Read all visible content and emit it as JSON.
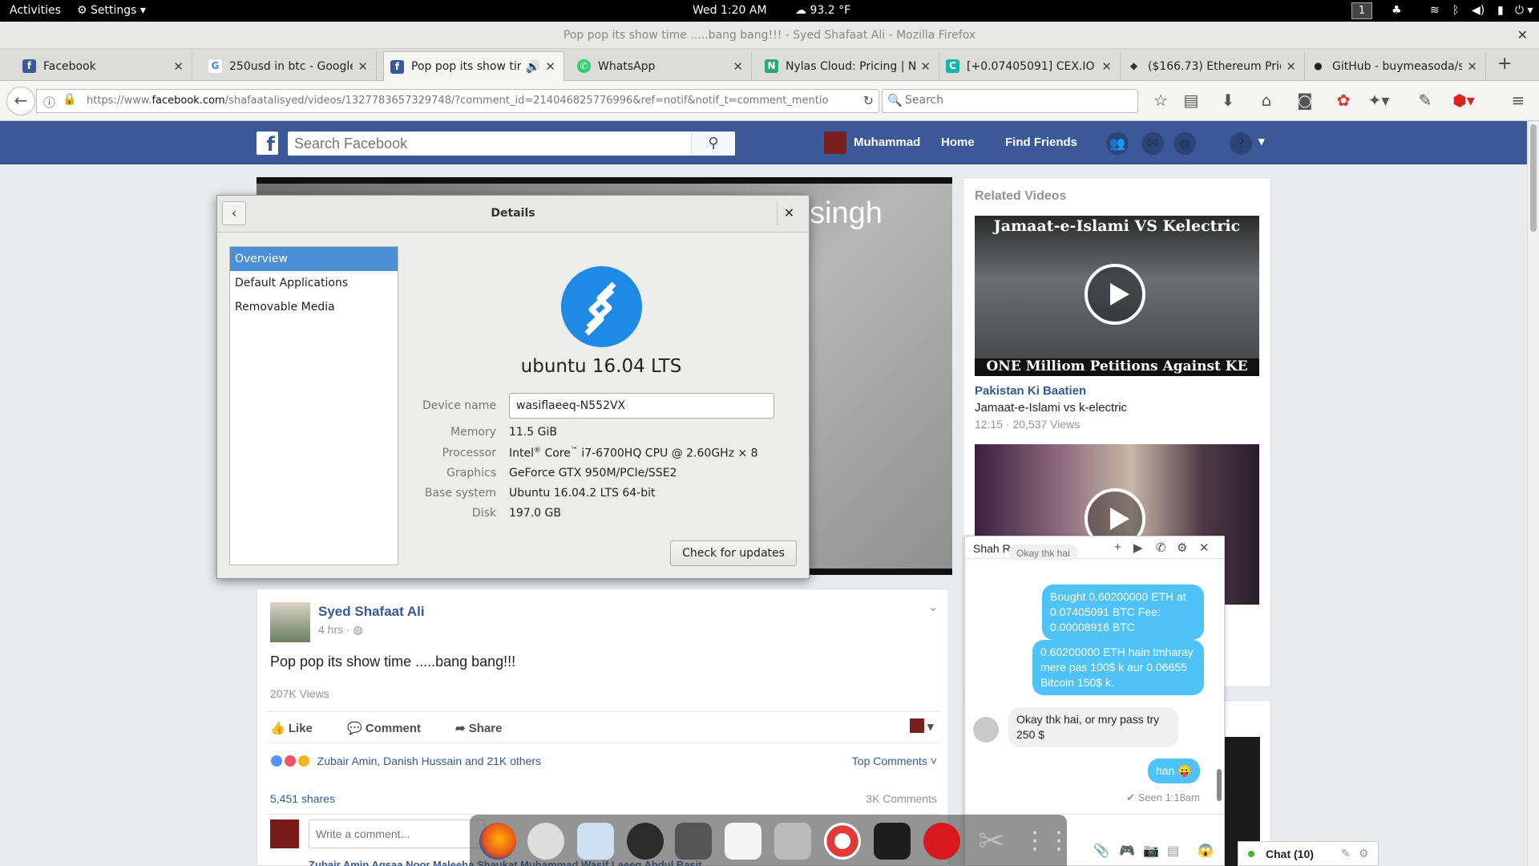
{
  "topbar": {
    "activities": "Activities",
    "settings_menu": "Settings ▾",
    "clock": "Wed  1:20 AM",
    "weather": "93.2 °F",
    "workspace": "1"
  },
  "window": {
    "title": "Pop pop its show time .....bang bang!!! - Syed Shafaat Ali - Mozilla Firefox"
  },
  "tabs": [
    {
      "label": "Facebook",
      "color": "#3b5998",
      "glyph": "f"
    },
    {
      "label": "250usd in btc - Google S",
      "color": "#ffffff",
      "glyph": "G"
    },
    {
      "label": "Pop pop its show tim",
      "color": "#3b5998",
      "glyph": "f"
    },
    {
      "label": "WhatsApp",
      "color": "#25d366",
      "glyph": "✆"
    },
    {
      "label": "Nylas Cloud: Pricing | N",
      "color": "#2aa876",
      "glyph": "N"
    },
    {
      "label": "[+0.07405091] CEX.IO",
      "color": "#19b5a4",
      "glyph": "C"
    },
    {
      "label": "($166.73) Ethereum Pric",
      "color": "#333333",
      "glyph": "◆"
    },
    {
      "label": "GitHub - buymeasoda/sc",
      "color": "#222222",
      "glyph": "●"
    }
  ],
  "navbar": {
    "url_host": "https://www.",
    "url_domain": "facebook.com",
    "url_path": "/shafaatalisyed/videos/1327783657329748/?comment_id=214046825776996&ref=notif&notif_t=comment_mentio",
    "search_placeholder": "Search"
  },
  "facebook": {
    "search_placeholder": "Search Facebook",
    "user_name": "Muhammad",
    "home": "Home",
    "find_friends": "Find Friends"
  },
  "video": {
    "caption_fragment": "singh"
  },
  "details_dialog": {
    "title": "Details",
    "sidebar": [
      "Overview",
      "Default Applications",
      "Removable Media"
    ],
    "os_name": "ubuntu 16.04 LTS",
    "device_name_label": "Device name",
    "device_name_value": "wasiflaeeq-N552VX",
    "memory_label": "Memory",
    "memory_value": "11.5 GiB",
    "processor_label": "Processor",
    "processor_brand": "Intel",
    "processor_core": "Core",
    "processor_model": "i7-6700HQ CPU @ 2.60GHz × 8",
    "graphics_label": "Graphics",
    "graphics_value": "GeForce GTX 950M/PCIe/SSE2",
    "base_label": "Base system",
    "base_value": "Ubuntu 16.04.2 LTS 64-bit",
    "disk_label": "Disk",
    "disk_value": "197.0 GB",
    "update_button": "Check for updates"
  },
  "post": {
    "author": "Syed Shafaat Ali",
    "time": "4 hrs · ",
    "text": "Pop pop its show time .....bang bang!!!",
    "views": "207K Views",
    "like": "Like",
    "comment": "Comment",
    "share": "Share",
    "reactions": "Zubair Amin, Danish Hussain and 21K others",
    "top_comments": "Top Comments ˅",
    "shares": "5,451 shares",
    "comments_count": "3K Comments",
    "comment_placeholder": "Write a comment...",
    "below_names": "Zubair Amin  Aqsaa Noor Maleeha  Shaukat Muhammad  Wasif Laeeq  Abdul Basit"
  },
  "related": {
    "header": "Related Videos",
    "video1_top_text": "Jamaat-e-Islami VS Kelectric",
    "video1_bottom_text": "ONE Milliom Petitions Against KE",
    "video1_channel": "Pakistan Ki Baatien",
    "video1_title": "Jamaat-e-Islami vs k-electric",
    "video1_meta": "12:15 · 20,537 Views"
  },
  "chat": {
    "name": "Shah Rukh",
    "partial_message": "Okay thk hai",
    "msg1": "Bought 0.60200000 ETH at 0.07405091 BTC Fee: 0.00008916 BTC",
    "msg2": "0.60200000 ETH hain tmharay mere pas 100$ k aur 0.06655 Bitcoin 150$ k.",
    "msg3": "Okay thk hai, or mry pass try 250 $",
    "msg4": "han 😛",
    "seen": "✔ Seen 1:18am",
    "bar_label": "Chat (10)"
  }
}
